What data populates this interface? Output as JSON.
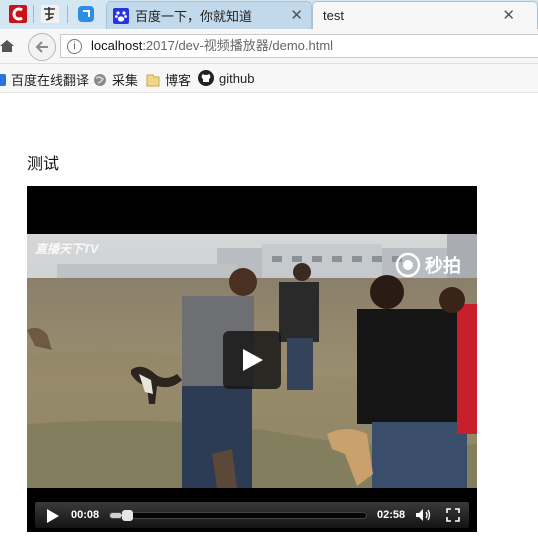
{
  "browser": {
    "tabs": [
      {
        "label": "百度一下，你就知道",
        "active": false
      },
      {
        "label": "test",
        "active": true
      }
    ],
    "address": {
      "host": "localhost",
      "path": ":2017/dev-视频播放器/demo.html"
    },
    "bookmarks": [
      {
        "label": "百度在线翻译",
        "icon": "translate-icon"
      },
      {
        "label": "采集",
        "icon": "globe-icon"
      },
      {
        "label": "博客",
        "icon": "folder-icon"
      },
      {
        "label": "github",
        "icon": "github-icon"
      }
    ]
  },
  "page": {
    "title": "测试",
    "video": {
      "watermark_left": "直播天下TV",
      "watermark_right": "秒拍",
      "current_time": "00:08",
      "duration": "02:58",
      "progress": 0.045
    }
  }
}
